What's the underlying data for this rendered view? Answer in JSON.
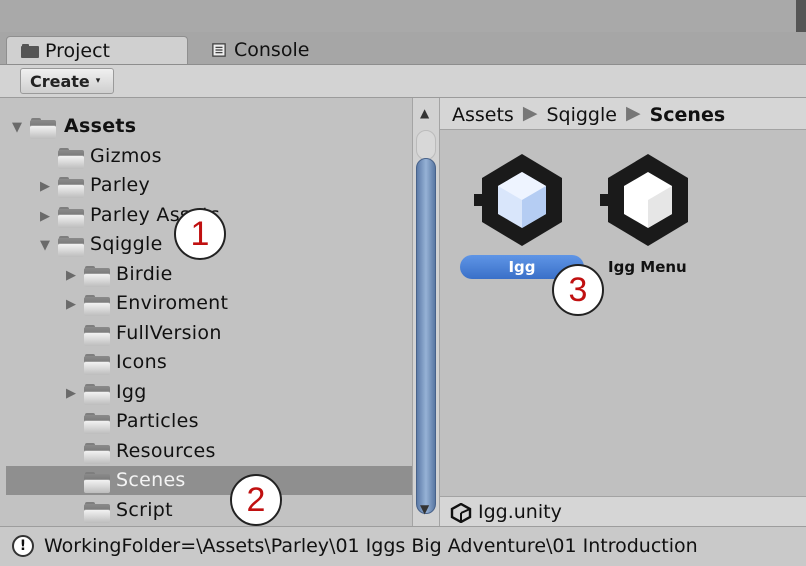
{
  "tabs": [
    {
      "label": "Project",
      "icon": "folder-icon",
      "active": true
    },
    {
      "label": "Console",
      "icon": "console-icon",
      "active": false
    }
  ],
  "toolbar": {
    "create_label": "Create",
    "create_arrow": "▾"
  },
  "tree": {
    "items": [
      {
        "label": "Assets",
        "expanded": true,
        "bold": true
      },
      {
        "label": "Gizmos"
      },
      {
        "label": "Parley",
        "expanded": false
      },
      {
        "label": "Parley Assets",
        "expanded": false
      },
      {
        "label": "Sqiggle",
        "expanded": true
      },
      {
        "label": "Birdie",
        "expanded": false
      },
      {
        "label": "Enviroment",
        "expanded": false
      },
      {
        "label": "FullVersion"
      },
      {
        "label": "Icons"
      },
      {
        "label": "Igg",
        "expanded": false
      },
      {
        "label": "Particles"
      },
      {
        "label": "Resources"
      },
      {
        "label": "Scenes",
        "selected": true
      },
      {
        "label": "Script"
      }
    ]
  },
  "breadcrumb": [
    "Assets",
    "Sqiggle",
    "Scenes"
  ],
  "assets": [
    {
      "label": "Igg",
      "selected": true,
      "icon": "unity-scene-icon"
    },
    {
      "label": "Igg Menu",
      "selected": false,
      "icon": "unity-scene-icon"
    }
  ],
  "selected_file": "Igg.unity",
  "status_message": "WorkingFolder=\\Assets\\Parley\\01 Iggs Big Adventure\\01 Introduction",
  "status_icon": "!",
  "callouts": [
    "1",
    "2",
    "3"
  ],
  "colors": {
    "selection_blue": "#3a70c8",
    "callout_red": "#c01010",
    "tree_selection": "#8f8f8f"
  }
}
